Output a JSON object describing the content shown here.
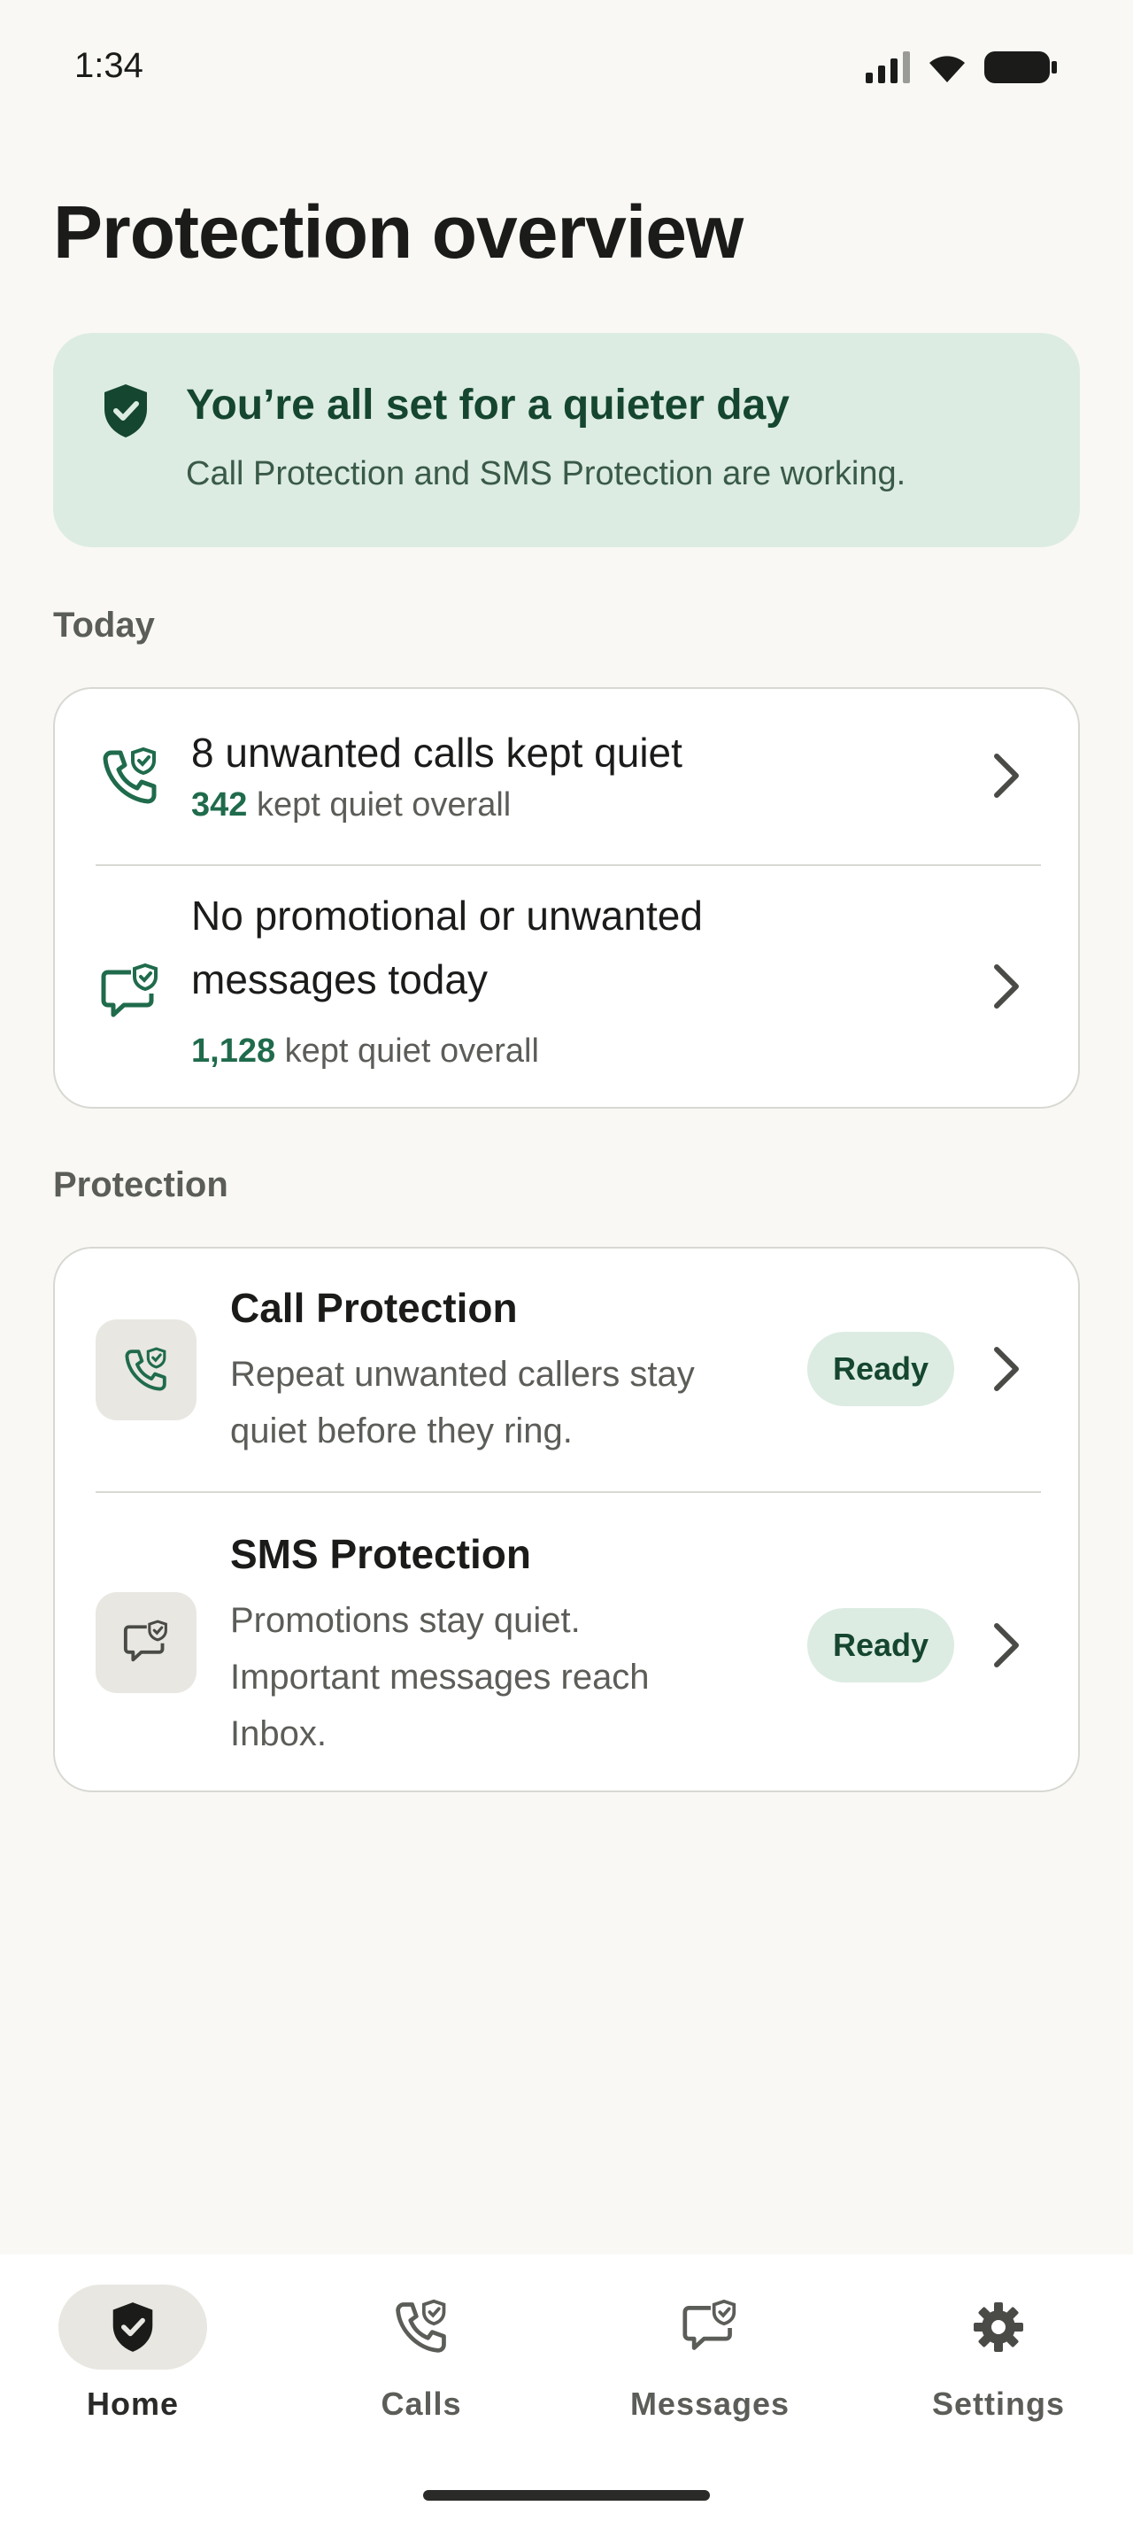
{
  "status_bar": {
    "time": "1:34"
  },
  "page": {
    "title": "Protection overview"
  },
  "banner": {
    "title": "You’re all set for a quieter day",
    "subtitle": "Call Protection and SMS Protection are working."
  },
  "today": {
    "label": "Today",
    "calls": {
      "title": "8 unwanted calls kept quiet",
      "count": "342",
      "suffix": " kept quiet overall"
    },
    "messages": {
      "title_line1": "No promotional or unwanted",
      "title_line2": "messages today",
      "count": "1,128",
      "suffix": " kept quiet overall"
    }
  },
  "protection": {
    "label": "Protection",
    "call": {
      "title": "Call Protection",
      "desc": "Repeat unwanted callers stay quiet before they ring.",
      "status": "Ready"
    },
    "sms": {
      "title": "SMS Protection",
      "desc": "Promotions stay quiet. Important messages reach Inbox.",
      "status": "Ready"
    }
  },
  "nav": {
    "home": "Home",
    "calls": "Calls",
    "messages": "Messages",
    "settings": "Settings",
    "active": "Home"
  },
  "colors": {
    "accent": "#1f6b4c",
    "banner_bg": "#dcece3",
    "banner_text": "#15462f"
  }
}
